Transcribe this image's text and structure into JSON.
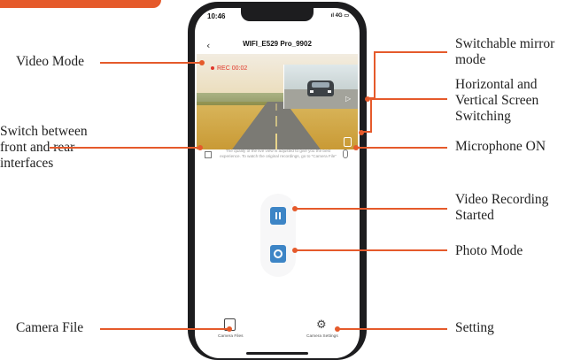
{
  "callouts": {
    "video_mode": "Video Mode",
    "mirror_mode": "Switchable mirror\nmode",
    "orientation": "Horizontal and\nVertical Screen\nSwitching",
    "switch_front_rear": "Switch between\nfront and rear\ninterfaces",
    "microphone": "Microphone ON",
    "recording_started": "Video Recording\nStarted",
    "photo_mode": "Photo Mode",
    "camera_file": "Camera File",
    "setting": "Setting"
  },
  "phone": {
    "status": {
      "time": "10:46",
      "signal": "ıl 4G ▭"
    },
    "nav": {
      "back_icon": "chevron-left-icon",
      "title": "WIFI_E529 Pro_9902"
    },
    "video": {
      "rec_label": "REC 00:02"
    },
    "notice": "The quality of the live view is adjusted to give you the best experience. To watch the original recordings, go to \"Camera File\"",
    "bottom_tabs": {
      "files": "Camera Files",
      "settings": "Camera Settings"
    }
  },
  "colors": {
    "accent": "#e55a2b",
    "button_blue": "#3d85c6",
    "rec_red": "#e0372b",
    "phone_frame": "#1d1d1f"
  }
}
